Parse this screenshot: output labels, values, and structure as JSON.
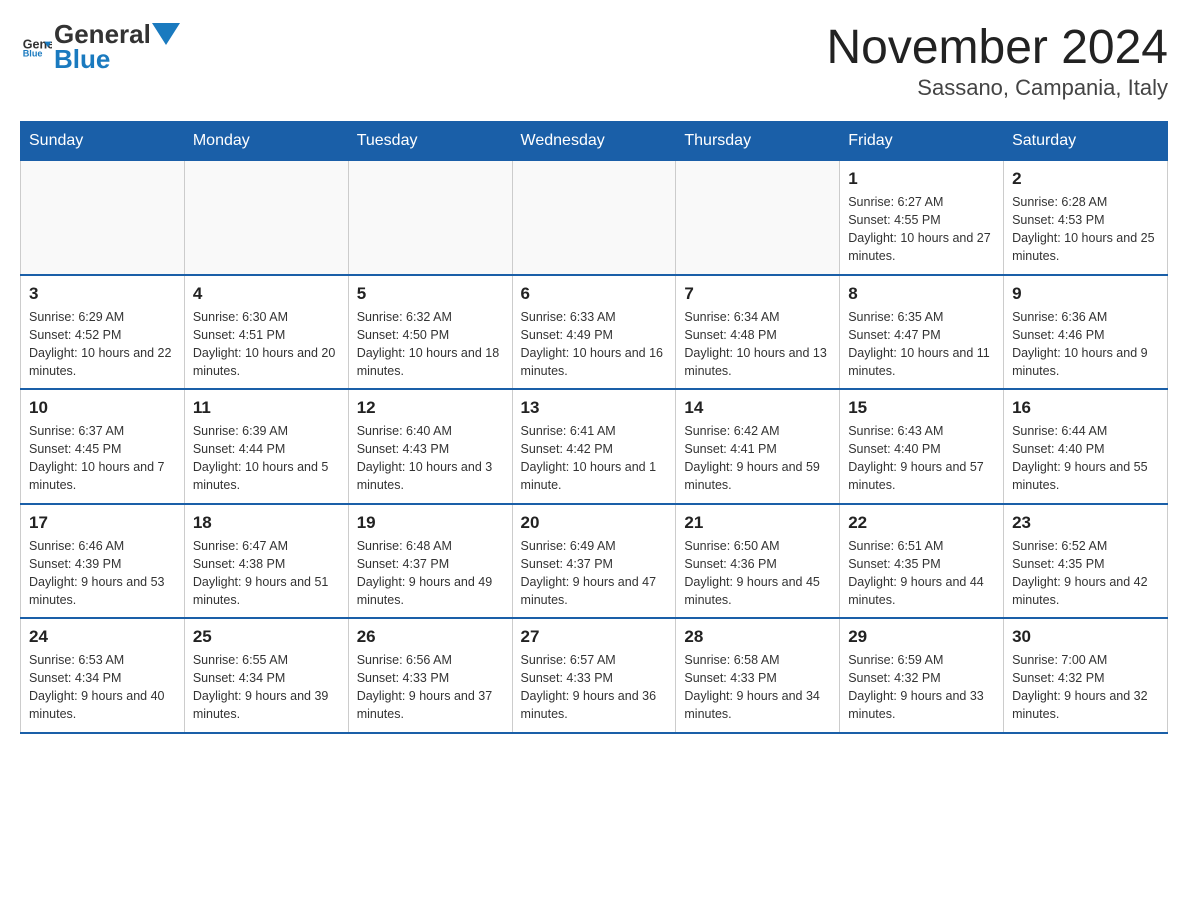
{
  "header": {
    "logo_general": "General",
    "logo_blue": "Blue",
    "title": "November 2024",
    "subtitle": "Sassano, Campania, Italy"
  },
  "days_of_week": [
    "Sunday",
    "Monday",
    "Tuesday",
    "Wednesday",
    "Thursday",
    "Friday",
    "Saturday"
  ],
  "weeks": [
    [
      {
        "day": "",
        "info": ""
      },
      {
        "day": "",
        "info": ""
      },
      {
        "day": "",
        "info": ""
      },
      {
        "day": "",
        "info": ""
      },
      {
        "day": "",
        "info": ""
      },
      {
        "day": "1",
        "info": "Sunrise: 6:27 AM\nSunset: 4:55 PM\nDaylight: 10 hours and 27 minutes."
      },
      {
        "day": "2",
        "info": "Sunrise: 6:28 AM\nSunset: 4:53 PM\nDaylight: 10 hours and 25 minutes."
      }
    ],
    [
      {
        "day": "3",
        "info": "Sunrise: 6:29 AM\nSunset: 4:52 PM\nDaylight: 10 hours and 22 minutes."
      },
      {
        "day": "4",
        "info": "Sunrise: 6:30 AM\nSunset: 4:51 PM\nDaylight: 10 hours and 20 minutes."
      },
      {
        "day": "5",
        "info": "Sunrise: 6:32 AM\nSunset: 4:50 PM\nDaylight: 10 hours and 18 minutes."
      },
      {
        "day": "6",
        "info": "Sunrise: 6:33 AM\nSunset: 4:49 PM\nDaylight: 10 hours and 16 minutes."
      },
      {
        "day": "7",
        "info": "Sunrise: 6:34 AM\nSunset: 4:48 PM\nDaylight: 10 hours and 13 minutes."
      },
      {
        "day": "8",
        "info": "Sunrise: 6:35 AM\nSunset: 4:47 PM\nDaylight: 10 hours and 11 minutes."
      },
      {
        "day": "9",
        "info": "Sunrise: 6:36 AM\nSunset: 4:46 PM\nDaylight: 10 hours and 9 minutes."
      }
    ],
    [
      {
        "day": "10",
        "info": "Sunrise: 6:37 AM\nSunset: 4:45 PM\nDaylight: 10 hours and 7 minutes."
      },
      {
        "day": "11",
        "info": "Sunrise: 6:39 AM\nSunset: 4:44 PM\nDaylight: 10 hours and 5 minutes."
      },
      {
        "day": "12",
        "info": "Sunrise: 6:40 AM\nSunset: 4:43 PM\nDaylight: 10 hours and 3 minutes."
      },
      {
        "day": "13",
        "info": "Sunrise: 6:41 AM\nSunset: 4:42 PM\nDaylight: 10 hours and 1 minute."
      },
      {
        "day": "14",
        "info": "Sunrise: 6:42 AM\nSunset: 4:41 PM\nDaylight: 9 hours and 59 minutes."
      },
      {
        "day": "15",
        "info": "Sunrise: 6:43 AM\nSunset: 4:40 PM\nDaylight: 9 hours and 57 minutes."
      },
      {
        "day": "16",
        "info": "Sunrise: 6:44 AM\nSunset: 4:40 PM\nDaylight: 9 hours and 55 minutes."
      }
    ],
    [
      {
        "day": "17",
        "info": "Sunrise: 6:46 AM\nSunset: 4:39 PM\nDaylight: 9 hours and 53 minutes."
      },
      {
        "day": "18",
        "info": "Sunrise: 6:47 AM\nSunset: 4:38 PM\nDaylight: 9 hours and 51 minutes."
      },
      {
        "day": "19",
        "info": "Sunrise: 6:48 AM\nSunset: 4:37 PM\nDaylight: 9 hours and 49 minutes."
      },
      {
        "day": "20",
        "info": "Sunrise: 6:49 AM\nSunset: 4:37 PM\nDaylight: 9 hours and 47 minutes."
      },
      {
        "day": "21",
        "info": "Sunrise: 6:50 AM\nSunset: 4:36 PM\nDaylight: 9 hours and 45 minutes."
      },
      {
        "day": "22",
        "info": "Sunrise: 6:51 AM\nSunset: 4:35 PM\nDaylight: 9 hours and 44 minutes."
      },
      {
        "day": "23",
        "info": "Sunrise: 6:52 AM\nSunset: 4:35 PM\nDaylight: 9 hours and 42 minutes."
      }
    ],
    [
      {
        "day": "24",
        "info": "Sunrise: 6:53 AM\nSunset: 4:34 PM\nDaylight: 9 hours and 40 minutes."
      },
      {
        "day": "25",
        "info": "Sunrise: 6:55 AM\nSunset: 4:34 PM\nDaylight: 9 hours and 39 minutes."
      },
      {
        "day": "26",
        "info": "Sunrise: 6:56 AM\nSunset: 4:33 PM\nDaylight: 9 hours and 37 minutes."
      },
      {
        "day": "27",
        "info": "Sunrise: 6:57 AM\nSunset: 4:33 PM\nDaylight: 9 hours and 36 minutes."
      },
      {
        "day": "28",
        "info": "Sunrise: 6:58 AM\nSunset: 4:33 PM\nDaylight: 9 hours and 34 minutes."
      },
      {
        "day": "29",
        "info": "Sunrise: 6:59 AM\nSunset: 4:32 PM\nDaylight: 9 hours and 33 minutes."
      },
      {
        "day": "30",
        "info": "Sunrise: 7:00 AM\nSunset: 4:32 PM\nDaylight: 9 hours and 32 minutes."
      }
    ]
  ]
}
